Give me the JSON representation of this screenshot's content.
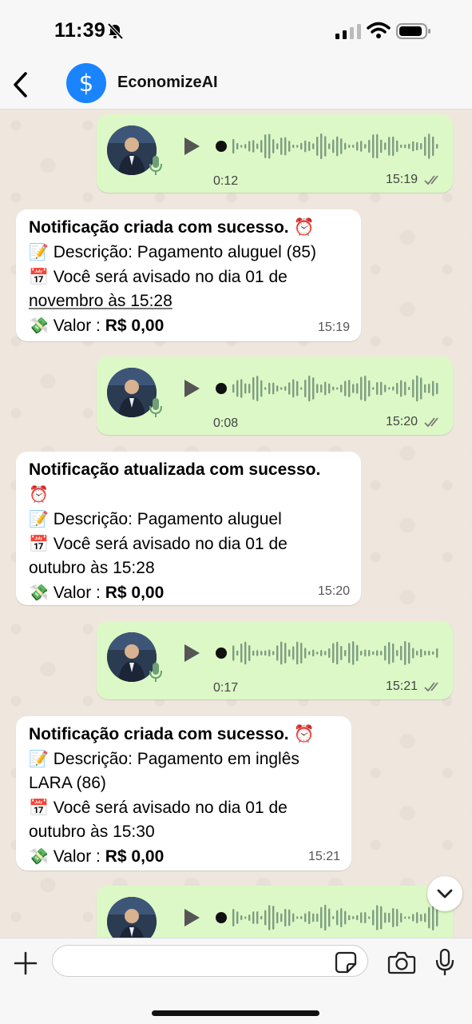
{
  "status_bar": {
    "time": "11:39"
  },
  "header": {
    "chat_name": "EconomizeAI",
    "avatar_symbol": "$"
  },
  "messages": [
    {
      "type": "voice",
      "duration": "0:12",
      "time": "15:19"
    },
    {
      "type": "text",
      "title": "Notificação criada com sucesso. ⏰",
      "description_label": "Descrição: Pagamento aluguel (85)",
      "reminder_lines": [
        "Você será avisado no dia 01 de",
        "novembro às 15:28"
      ],
      "value_label": "Valor : ",
      "value": "R$ 0,00",
      "time": "15:19"
    },
    {
      "type": "voice",
      "duration": "0:08",
      "time": "15:20"
    },
    {
      "type": "text",
      "title": "Notificação atualizada com sucesso.",
      "title_emoji": "⏰",
      "description_label": "Descrição: Pagamento aluguel",
      "reminder_lines": [
        "Você será avisado no dia 01 de",
        "outubro às 15:28"
      ],
      "value_label": "Valor : ",
      "value": "R$ 0,00",
      "time": "15:20"
    },
    {
      "type": "voice",
      "duration": "0:17",
      "time": "15:21"
    },
    {
      "type": "text",
      "title": "Notificação criada com sucesso. ⏰",
      "description_lines": [
        "Descrição: Pagamento em inglês",
        "LARA (86)"
      ],
      "reminder_lines": [
        "Você será avisado no dia 01 de",
        "outubro às 15:30"
      ],
      "value_label": "Valor : ",
      "value": "R$ 0,00",
      "time": "15:21"
    },
    {
      "type": "voice",
      "duration": "",
      "time": ""
    }
  ],
  "emoji": {
    "memo": "📝",
    "calendar": "📅",
    "money": "💸"
  },
  "composer": {
    "placeholder": ""
  },
  "colors": {
    "outgoing_bubble": "#dcf8c6",
    "incoming_bubble": "#ffffff",
    "chat_background": "#efe7de",
    "avatar_blue": "#1a84ff"
  }
}
